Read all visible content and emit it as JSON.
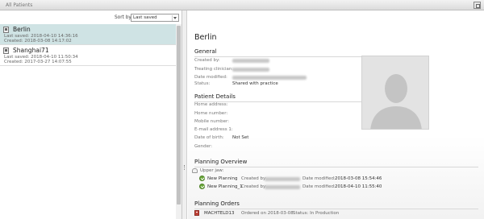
{
  "header": {
    "title": "All Patients",
    "toolbar_icon": "window-icon"
  },
  "sort": {
    "label": "Sort by",
    "selected": "Last saved"
  },
  "patients": [
    {
      "name": "Berlin",
      "last_saved": "Last saved: 2018-04-10 14:36:16",
      "created": "Created: 2018-03-08 14:17:02",
      "selected": true
    },
    {
      "name": "Shanghai71",
      "last_saved": "Last saved: 2018-04-10 11:50:34",
      "created": "Created: 2017-03-27 14:07:55",
      "selected": false
    }
  ],
  "detail": {
    "title": "Berlin",
    "general": {
      "heading": "General",
      "created_by_label": "Created by:",
      "clinician_label": "Treating clinician:",
      "date_modified_label": "Date modified:",
      "status_label": "Status:",
      "status_value": "Shared with practice"
    },
    "patient_details": {
      "heading": "Patient Details",
      "home_address_label": "Home address:",
      "home_number_label": "Home number:",
      "mobile_number_label": "Mobile number:",
      "email_label": "E-mail address 1:",
      "dob_label": "Date of birth:",
      "dob_value": "Not Set",
      "gender_label": "Gender:"
    },
    "planning_overview": {
      "heading": "Planning Overview",
      "jaw_label": "Upper jaw:",
      "created_by_label": "Created by:",
      "date_modified_label": "Date modified:",
      "plans": [
        {
          "name": "New Planning",
          "date": "2018-03-08 15:54:46"
        },
        {
          "name": "New Planning_1",
          "date": "2018-04-10 11:55:40"
        }
      ]
    },
    "planning_orders": {
      "heading": "Planning Orders",
      "order_id": "MACHTELD13",
      "ordered_on": "Ordered on 2018-03-08",
      "status": "Status: In Production"
    }
  },
  "colors": {
    "selected_row": "#cfe3e4",
    "accent_green": "#6aa83a",
    "order_red": "#c0443a"
  }
}
